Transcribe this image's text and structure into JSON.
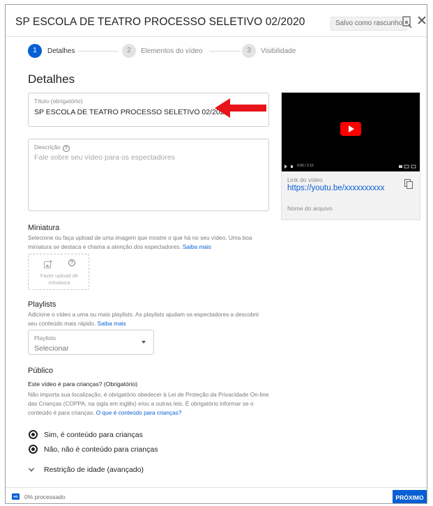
{
  "colors": {
    "accent": "#065fd4",
    "arrow": "#e8141a",
    "play": "#ff0000"
  },
  "header": {
    "title": "SP ESCOLA DE TEATRO PROCESSO SELETIVO 02/2020",
    "draft_status": "Salvo como rascunho",
    "feedback_icon": "feedback-icon",
    "close_icon": "close-icon"
  },
  "steps": [
    {
      "number": "1",
      "label": "Detalhes",
      "state": "active"
    },
    {
      "number": "2",
      "label": "Elementos do vídeo",
      "state": "idle"
    },
    {
      "number": "3",
      "label": "Visibilidade",
      "state": "idle"
    }
  ],
  "details": {
    "section_title": "Detalhes",
    "title_field": {
      "label": "Título (obrigatório)",
      "value": "SP ESCOLA DE TEATRO PROCESSO SELETIVO 02/2020"
    },
    "description_field": {
      "label": "Descrição",
      "placeholder": "Fale sobre seu vídeo para os espectadores"
    }
  },
  "preview": {
    "time": "0:00 / 2:10",
    "link_label": "Link do vídeo",
    "link": "https://youtu.be/xxxxxxxxxx",
    "filename_label": "Nome do arquivo"
  },
  "thumbnail": {
    "heading": "Miniatura",
    "description": "Selecione ou faça upload de uma imagem que mostre o que há no seu vídeo. Uma boa miniatura se destaca e chama a atenção dos espectadores.",
    "learn_more": "Saiba mais",
    "upload_label": "Fazer upload de miniatura"
  },
  "playlists": {
    "heading": "Playlists",
    "description": "Adicione o vídeo a uma ou mais playlists. As playlists ajudam os espectadores a descobrir seu conteúdo mais rápido.",
    "learn_more": "Saiba mais",
    "select_label": "Playlists",
    "select_value": "Selecionar"
  },
  "audience": {
    "heading": "Público",
    "question": "Este vídeo é para crianças? (Obrigatório)",
    "description": "Não importa sua localização, é obrigatório obedecer à Lei de Proteção da Privacidade On-line das Crianças (COPPA, na sigla em inglês) e/ou a outras leis. É obrigatório informar se o conteúdo é para crianças.",
    "learn_more": "O que é conteúdo para crianças?",
    "options": [
      {
        "label": "Sim, é conteúdo para crianças",
        "selected": true
      },
      {
        "label": "Não, não é conteúdo para crianças",
        "selected": true
      }
    ],
    "age_restriction": "Restrição de idade (avançado)"
  },
  "footer": {
    "badge": "HD",
    "status": "0% processado",
    "next_label": "PRÓXIMO"
  }
}
